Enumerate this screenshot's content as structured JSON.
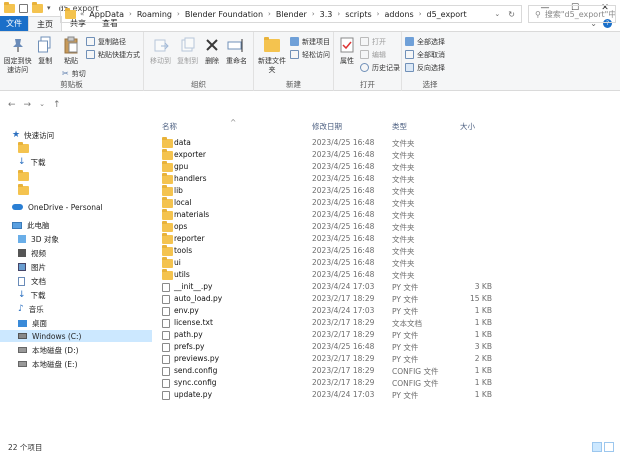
{
  "window": {
    "title": "d5_export",
    "minimize": "—",
    "maximize": "☐",
    "close": "✕"
  },
  "ribbon_tabs": {
    "file": "文件",
    "home": "主页",
    "share": "共享",
    "view": "查看"
  },
  "ribbon": {
    "clipboard": {
      "label": "剪贴板",
      "pin": "固定到快速访问",
      "copy": "复制",
      "paste": "粘贴",
      "copy_path": "复制路径",
      "paste_shortcut": "粘贴快捷方式",
      "cut": "剪切"
    },
    "organize": {
      "label": "组织",
      "move_to": "移动到",
      "copy_to": "复制到",
      "delete": "删除",
      "rename": "重命名"
    },
    "new": {
      "label": "新建",
      "new_folder": "新建文件夹",
      "new_item": "新建项目",
      "easy_access": "轻松访问"
    },
    "open": {
      "label": "打开",
      "properties": "属性",
      "open": "打开",
      "edit": "编辑",
      "history": "历史记录"
    },
    "select": {
      "label": "选择",
      "select_all": "全部选择",
      "select_none": "全部取消",
      "invert": "反向选择"
    }
  },
  "address": {
    "crumbs": [
      "AppData",
      "Roaming",
      "Blender Foundation",
      "Blender",
      "3.3",
      "scripts",
      "addons",
      "d5_export"
    ],
    "search_placeholder": "搜索\"d5_export\"中..."
  },
  "nav": {
    "quick_access": "快速访问",
    "downloads": "下载",
    "onedrive": "OneDrive - Personal",
    "this_pc": "此电脑",
    "objects_3d": "3D 对象",
    "videos": "视频",
    "pictures": "图片",
    "documents": "文档",
    "downloads2": "下载",
    "music": "音乐",
    "desktop": "桌面",
    "drive_c": "Windows (C:)",
    "drive_d": "本地磁盘 (D:)",
    "drive_e": "本地磁盘 (E:)"
  },
  "columns": {
    "name": "名称",
    "date": "修改日期",
    "type": "类型",
    "size": "大小"
  },
  "files": [
    {
      "name": "data",
      "date": "2023/4/25 16:48",
      "type": "文件夹",
      "size": "",
      "kind": "folder"
    },
    {
      "name": "exporter",
      "date": "2023/4/25 16:48",
      "type": "文件夹",
      "size": "",
      "kind": "folder"
    },
    {
      "name": "gpu",
      "date": "2023/4/25 16:48",
      "type": "文件夹",
      "size": "",
      "kind": "folder"
    },
    {
      "name": "handlers",
      "date": "2023/4/25 16:48",
      "type": "文件夹",
      "size": "",
      "kind": "folder"
    },
    {
      "name": "lib",
      "date": "2023/4/25 16:48",
      "type": "文件夹",
      "size": "",
      "kind": "folder"
    },
    {
      "name": "local",
      "date": "2023/4/25 16:48",
      "type": "文件夹",
      "size": "",
      "kind": "folder"
    },
    {
      "name": "materials",
      "date": "2023/4/25 16:48",
      "type": "文件夹",
      "size": "",
      "kind": "folder"
    },
    {
      "name": "ops",
      "date": "2023/4/25 16:48",
      "type": "文件夹",
      "size": "",
      "kind": "folder"
    },
    {
      "name": "reporter",
      "date": "2023/4/25 16:48",
      "type": "文件夹",
      "size": "",
      "kind": "folder"
    },
    {
      "name": "tools",
      "date": "2023/4/25 16:48",
      "type": "文件夹",
      "size": "",
      "kind": "folder"
    },
    {
      "name": "ui",
      "date": "2023/4/25 16:48",
      "type": "文件夹",
      "size": "",
      "kind": "folder"
    },
    {
      "name": "utils",
      "date": "2023/4/25 16:48",
      "type": "文件夹",
      "size": "",
      "kind": "folder"
    },
    {
      "name": "__init__.py",
      "date": "2023/4/24 17:03",
      "type": "PY 文件",
      "size": "3 KB",
      "kind": "file"
    },
    {
      "name": "auto_load.py",
      "date": "2023/2/17 18:29",
      "type": "PY 文件",
      "size": "15 KB",
      "kind": "file"
    },
    {
      "name": "env.py",
      "date": "2023/4/24 17:03",
      "type": "PY 文件",
      "size": "1 KB",
      "kind": "file"
    },
    {
      "name": "license.txt",
      "date": "2023/2/17 18:29",
      "type": "文本文档",
      "size": "1 KB",
      "kind": "file"
    },
    {
      "name": "path.py",
      "date": "2023/2/17 18:29",
      "type": "PY 文件",
      "size": "1 KB",
      "kind": "file"
    },
    {
      "name": "prefs.py",
      "date": "2023/4/25 16:48",
      "type": "PY 文件",
      "size": "3 KB",
      "kind": "file"
    },
    {
      "name": "previews.py",
      "date": "2023/2/17 18:29",
      "type": "PY 文件",
      "size": "2 KB",
      "kind": "file"
    },
    {
      "name": "send.config",
      "date": "2023/2/17 18:29",
      "type": "CONFIG 文件",
      "size": "1 KB",
      "kind": "file"
    },
    {
      "name": "sync.config",
      "date": "2023/2/17 18:29",
      "type": "CONFIG 文件",
      "size": "1 KB",
      "kind": "file"
    },
    {
      "name": "update.py",
      "date": "2023/4/24 17:03",
      "type": "PY 文件",
      "size": "1 KB",
      "kind": "file"
    }
  ],
  "status": {
    "count": "22 个项目"
  },
  "colors": {
    "accent": "#1a6fc9",
    "folder": "#f4c34f",
    "selection": "#cce8ff",
    "header_text": "#4d6082"
  }
}
